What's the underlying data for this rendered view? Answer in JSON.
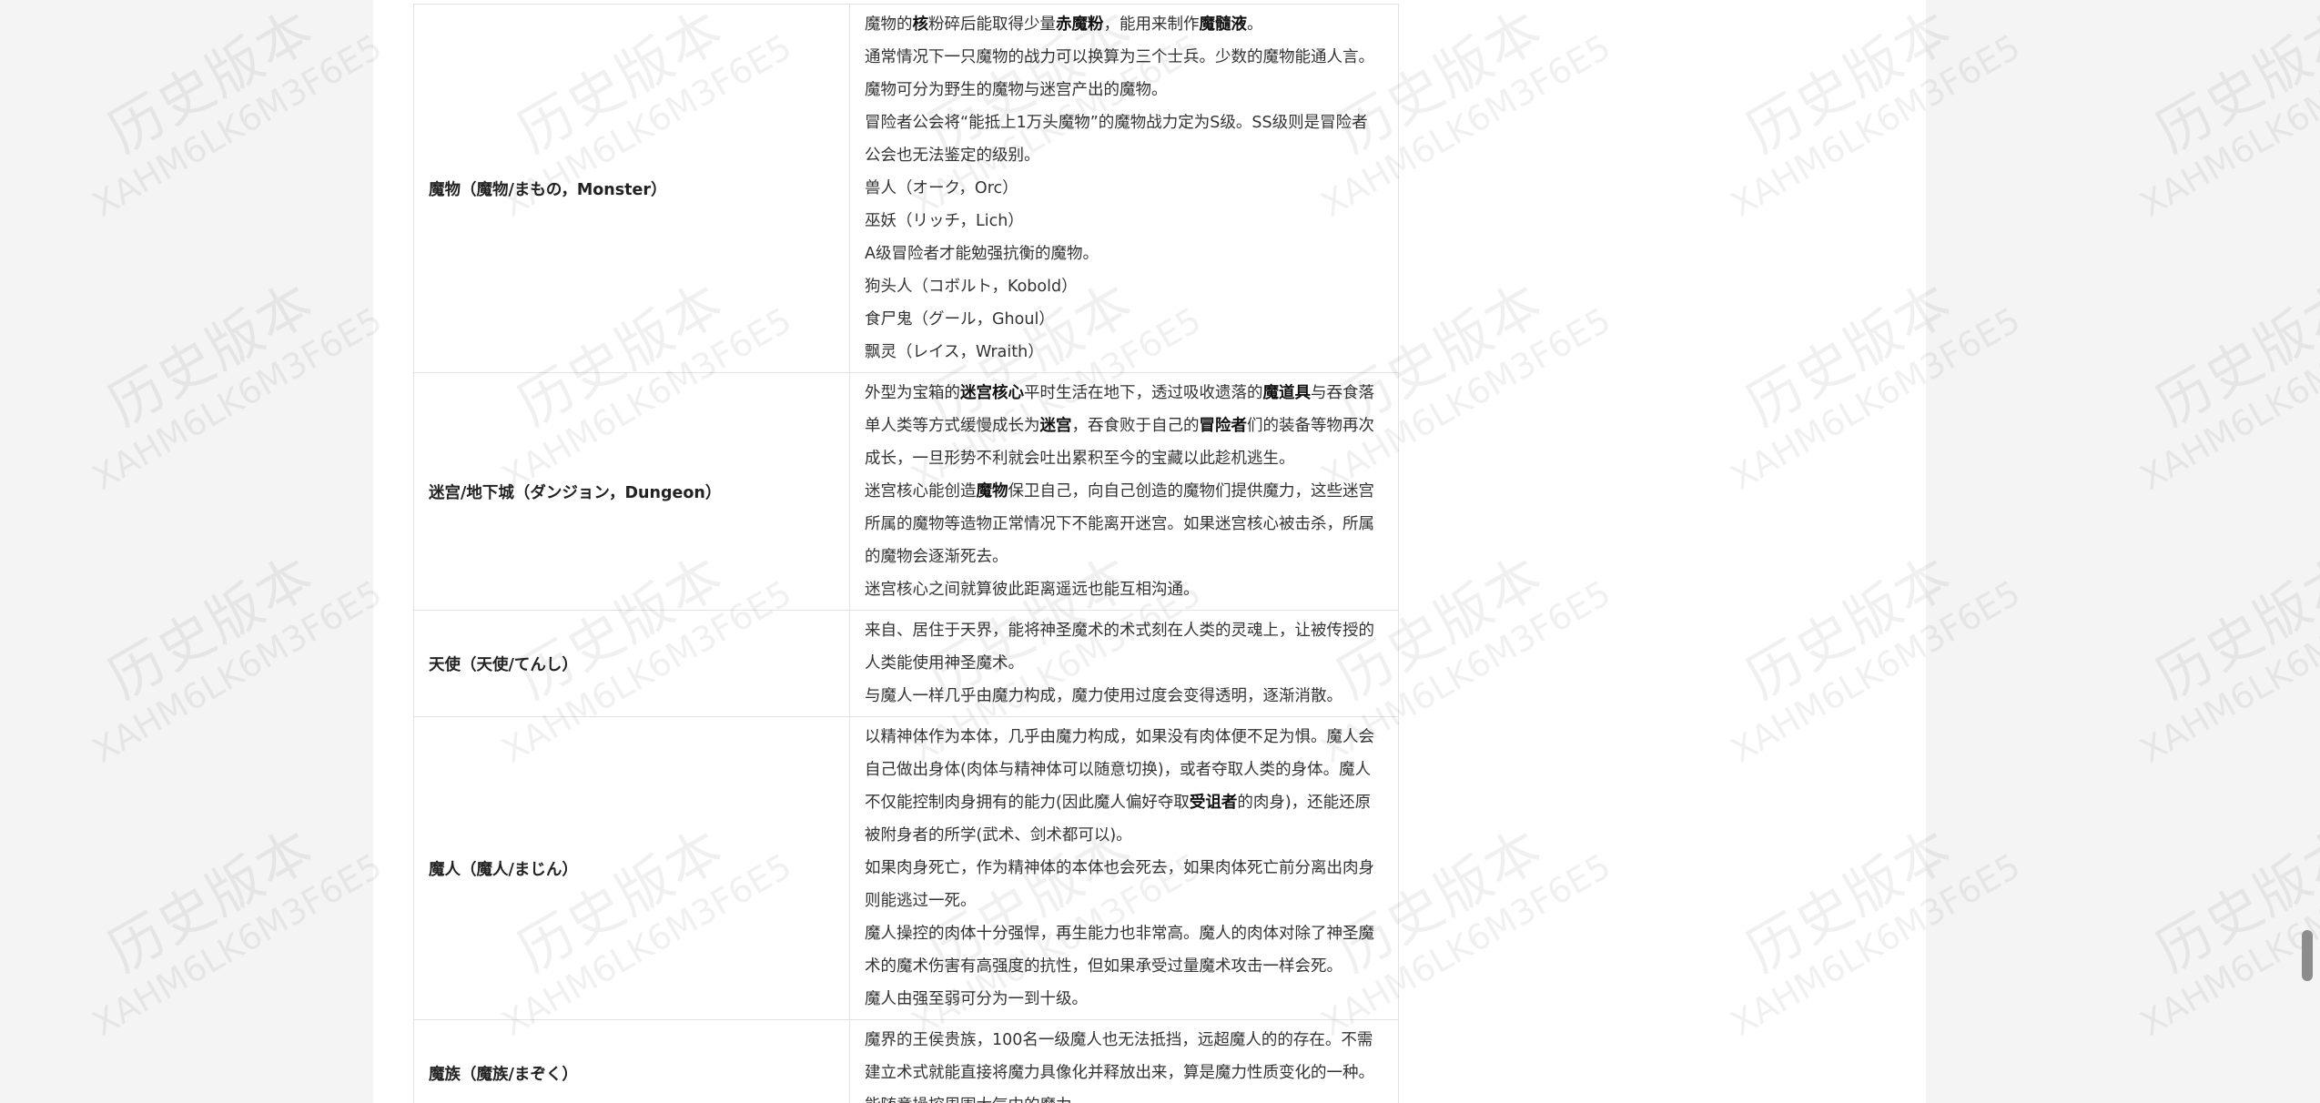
{
  "watermark": {
    "line1": "历史版本",
    "line2": "XAHM6LK6M3F6E5"
  },
  "rows": [
    {
      "term": "魔物（魔物/まもの，Monster）",
      "paragraphs": [
        [
          "魔物的",
          {
            "b": "核"
          },
          "粉碎后能取得少量",
          {
            "b": "赤魔粉"
          },
          "，能用来制作",
          {
            "b": "魔髓液"
          },
          "。"
        ],
        [
          "通常情况下一只魔物的战力可以换算为三个士兵。少数的魔物能通人言。"
        ],
        [
          "魔物可分为野生的魔物与迷宫产出的魔物。"
        ],
        [
          "冒险者公会将“能抵上1万头魔物”的魔物战力定为S级。SS级则是冒险者公会也无法鉴定的级别。"
        ],
        [
          "兽人（オーク，Orc）"
        ],
        [
          "巫妖（リッチ，Lich）"
        ],
        [
          "A级冒险者才能勉强抗衡的魔物。"
        ],
        [
          "狗头人（コボルト，Kobold）"
        ],
        [
          "食尸鬼（グール，Ghoul）"
        ],
        [
          "飘灵（レイス，Wraith）"
        ]
      ]
    },
    {
      "term": "迷宫/地下城（ダンジョン，Dungeon）",
      "paragraphs": [
        [
          "外型为宝箱的",
          {
            "b": "迷宫核心"
          },
          "平时生活在地下，透过吸收遗落的",
          {
            "b": "魔道具"
          },
          "与吞食落单人类等方式缓慢成长为",
          {
            "b": "迷宫"
          },
          "，吞食败于自己的",
          {
            "b": "冒险者"
          },
          "们的装备等物再次成长，一旦形势不利就会吐出累积至今的宝藏以此趁机逃生。"
        ],
        [
          "迷宫核心能创造",
          {
            "b": "魔物"
          },
          "保卫自己，向自己创造的魔物们提供魔力，这些迷宫所属的魔物等造物正常情况下不能离开迷宫。如果迷宫核心被击杀，所属的魔物会逐渐死去。"
        ],
        [
          "迷宫核心之间就算彼此距离遥远也能互相沟通。"
        ]
      ]
    },
    {
      "term": "天使（天使/てんし）",
      "paragraphs": [
        [
          "来自、居住于天界，能将神圣魔术的术式刻在人类的灵魂上，让被传授的人类能使用神圣魔术。"
        ],
        [
          "与魔人一样几乎由魔力构成，魔力使用过度会变得透明，逐渐消散。"
        ]
      ]
    },
    {
      "term": "魔人（魔人/まじん）",
      "paragraphs": [
        [
          "以精神体作为本体，几乎由魔力构成，如果没有肉体便不足为惧。魔人会自己做出身体(肉体与精神体可以随意切换)，或者夺取人类的身体。魔人不仅能控制肉身拥有的能力(因此魔人偏好夺取",
          {
            "b": "受诅者"
          },
          "的肉身)，还能还原被附身者的所学(武术、剑术都可以)。"
        ],
        [
          "如果肉身死亡，作为精神体的本体也会死去，如果肉体死亡前分离出肉身则能逃过一死。"
        ],
        [
          "魔人操控的肉体十分强悍，再生能力也非常高。魔人的肉体对除了神圣魔术的魔术伤害有高强度的抗性，但如果承受过量魔术攻击一样会死。"
        ],
        [
          "魔人由强至弱可分为一到十级。"
        ]
      ]
    },
    {
      "term": "魔族（魔族/まぞく）",
      "paragraphs": [
        [
          "魔界的王侯贵族，100名一级魔人也无法抵挡，远超魔人的的存在。不需建立术式就能直接将魔力具像化并释放出来，算是魔力性质变化的一种。能随意操控周围大气中的魔力。"
        ]
      ]
    }
  ]
}
